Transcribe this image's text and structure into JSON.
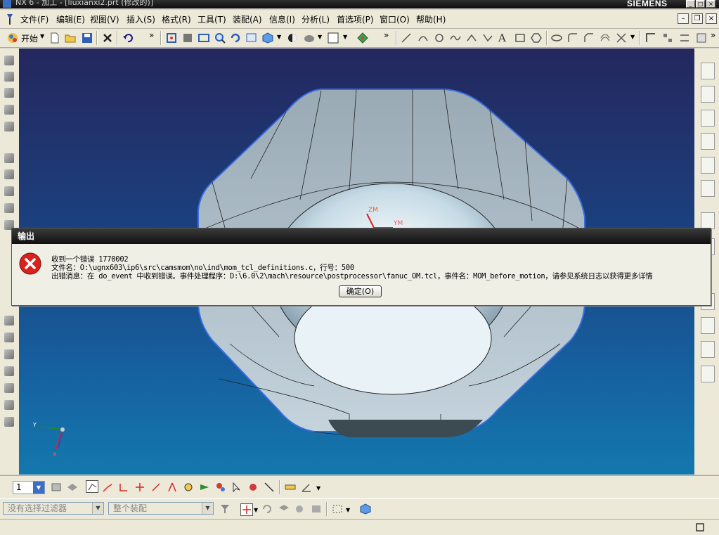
{
  "window": {
    "title": "NX 6 - 加工 - [liuxianxi2.prt (修改的)]",
    "brand": "SIEMENS",
    "minimize": "_",
    "maximize": "□",
    "close": "×"
  },
  "menu": [
    {
      "label": "文件(F)"
    },
    {
      "label": "编辑(E)"
    },
    {
      "label": "视图(V)"
    },
    {
      "label": "插入(S)"
    },
    {
      "label": "格式(R)"
    },
    {
      "label": "工具(T)"
    },
    {
      "label": "装配(A)"
    },
    {
      "label": "信息(I)"
    },
    {
      "label": "分析(L)"
    },
    {
      "label": "首选项(P)"
    },
    {
      "label": "窗口(O)"
    },
    {
      "label": "帮助(H)"
    }
  ],
  "toolbar": {
    "start_label": "开始",
    "more_label": "»"
  },
  "viewport": {
    "zm_label": "ZM",
    "ym_label": "YM",
    "triad_y": "Y",
    "triad_x": "X"
  },
  "dialog": {
    "title": "输出",
    "line1": "收到一个错误 1770002",
    "line2": "文件名：O:\\ugnx603\\ip6\\src\\camsmom\\no\\ind\\mom_tcl_definitions.c，行号：500",
    "line3": "出错消息：在 do_event 中收到错误。事件处理程序：D:\\6.0\\2\\mach\\resource\\postprocessor\\fanuc_OM.tcl，事件名：MOM_before_motion，请参见系统日志以获得更多详情",
    "ok_label": "确定(O)",
    "icon": "error-icon",
    "icon_color": "#d9221b"
  },
  "bottom": {
    "layer_value": "1"
  },
  "selection": {
    "filter_placeholder": "没有选择过滤器",
    "scope_placeholder": "整个装配"
  },
  "colors": {
    "viewport_top": "#24275e",
    "viewport_bottom": "#1478ad",
    "part": "#c8dce6"
  }
}
